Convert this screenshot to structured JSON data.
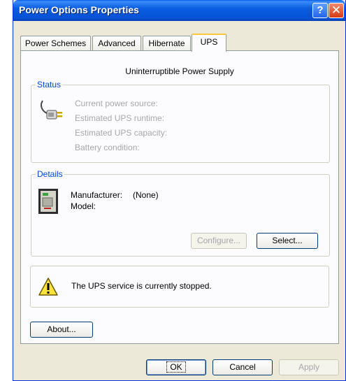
{
  "window": {
    "title": "Power Options Properties",
    "help_glyph": "?",
    "close_glyph": "✕"
  },
  "tabs": [
    {
      "label": "Power Schemes",
      "active": false
    },
    {
      "label": "Advanced",
      "active": false
    },
    {
      "label": "Hibernate",
      "active": false
    },
    {
      "label": "UPS",
      "active": true
    }
  ],
  "ups": {
    "heading": "Uninterruptible Power Supply",
    "status": {
      "legend": "Status",
      "icon": "power-plug-icon",
      "fields": [
        "Current power source:",
        "Estimated UPS runtime:",
        "Estimated UPS capacity:",
        "Battery condition:"
      ]
    },
    "details": {
      "legend": "Details",
      "icon": "ups-device-icon",
      "manufacturer_label": "Manufacturer:",
      "manufacturer_value": "(None)",
      "model_label": "Model:",
      "configure_button": "Configure...",
      "select_button": "Select..."
    },
    "warning": {
      "icon": "warning-icon",
      "message": "The UPS service is currently stopped."
    },
    "about_button": "About..."
  },
  "dialog_buttons": {
    "ok": "OK",
    "cancel": "Cancel",
    "apply": "Apply"
  },
  "colors": {
    "titlebar": "#0552d6",
    "group_legend": "#0046d5",
    "active_tab_highlight": "#ffc83c",
    "dialog_face": "#ece9d8"
  }
}
